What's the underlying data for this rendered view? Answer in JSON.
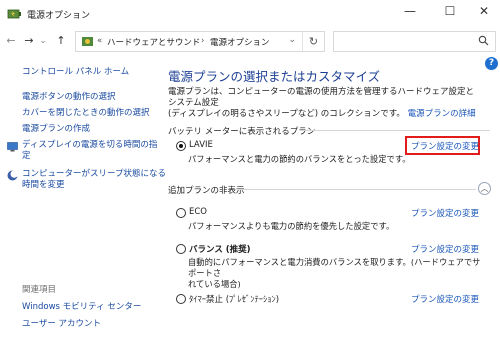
{
  "window": {
    "title": "電源オプション"
  },
  "titlebar_buttons": {
    "minimize": "—",
    "maximize": "☐",
    "close": "✕"
  },
  "nav": {
    "back": "←",
    "forward": "→",
    "dropdown": "⌄",
    "up": "↑"
  },
  "address": {
    "prefix": "«",
    "crumbs": [
      "ハードウェアとサウンド",
      "電源オプション"
    ],
    "separator": "›",
    "refresh": "↻",
    "chevron": "⌄"
  },
  "search": {
    "placeholder": ""
  },
  "help_icon": "?",
  "sidebar": {
    "home": "コントロール パネル ホーム",
    "links": [
      "電源ボタンの動作の選択",
      "カバーを閉じたときの動作の選択",
      "電源プランの作成"
    ],
    "icon_links": [
      {
        "line1": "ディスプレイの電源を切る時間の指",
        "line2": "定"
      },
      {
        "line1": "コンピューターがスリープ状態になる",
        "line2": "時間を変更"
      }
    ],
    "see_also_title": "関連項目",
    "see_also": [
      "Windows モビリティ センター",
      "ユーザー アカウント"
    ]
  },
  "main": {
    "title": "電源プランの選択またはカスタマイズ",
    "description_line1": "電源プランは、コンピューターの電源の使用方法を管理するハードウェア設定とシステム設定",
    "description_line2": "(ディスプレイの明るさやスリープなど) のコレクションです。",
    "description_link": "電源プランの詳細",
    "battery_section": "バッテリ メーターに表示されるプラン",
    "additional_section": "追加プランの非表示",
    "collapse_icon": "︿",
    "change_label": "プラン設定の変更",
    "plans": [
      {
        "name": "LAVIE",
        "desc1": "パフォーマンスと電力の節約のバランスをとった設定です。",
        "desc2": "",
        "selected": true
      },
      {
        "name": "ECO",
        "desc1": "パフォーマンスよりも電力の節約を優先した設定です。",
        "desc2": "",
        "selected": false
      },
      {
        "name": "バランス (推奨)",
        "desc1": "自動的にパフォーマンスと電力消費のバランスを取ります。(ハードウェアでサポートさ",
        "desc2": "れている場合)",
        "selected": false
      },
      {
        "name": "ﾀｲﾏｰ禁止 (ﾌﾟﾚｾﾞﾝﾃｰｼｮﾝ)",
        "desc1": "",
        "desc2": "",
        "selected": false
      }
    ]
  },
  "colors": {
    "link": "#1a56b8",
    "heading": "#1c3f94",
    "highlight": "#e21b1b"
  }
}
